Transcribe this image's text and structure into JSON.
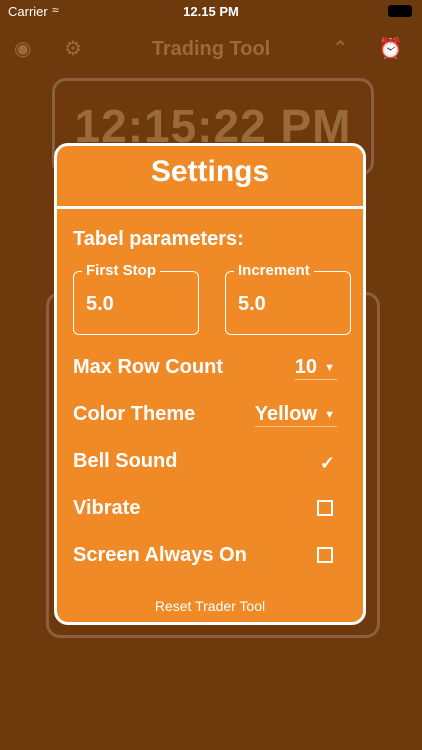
{
  "status_bar": {
    "carrier": "Carrier",
    "time": "12.15 PM"
  },
  "topbar": {
    "title": "Trading Tool"
  },
  "clock": {
    "time": "12:15:22 PM"
  },
  "settings": {
    "title": "Settings",
    "section_title": "Tabel parameters:",
    "first_stop": {
      "label": "First Stop",
      "value": "5.0"
    },
    "increment": {
      "label": "Increment",
      "value": "5.0"
    },
    "max_row_count": {
      "label": "Max Row Count",
      "value": "10"
    },
    "color_theme": {
      "label": "Color Theme",
      "value": "Yellow"
    },
    "bell_sound": {
      "label": "Bell Sound",
      "checked": true
    },
    "vibrate": {
      "label": "Vibrate",
      "checked": false
    },
    "screen_always_on": {
      "label": "Screen Always On",
      "checked": false
    },
    "reset_label": "Reset Trader Tool"
  }
}
